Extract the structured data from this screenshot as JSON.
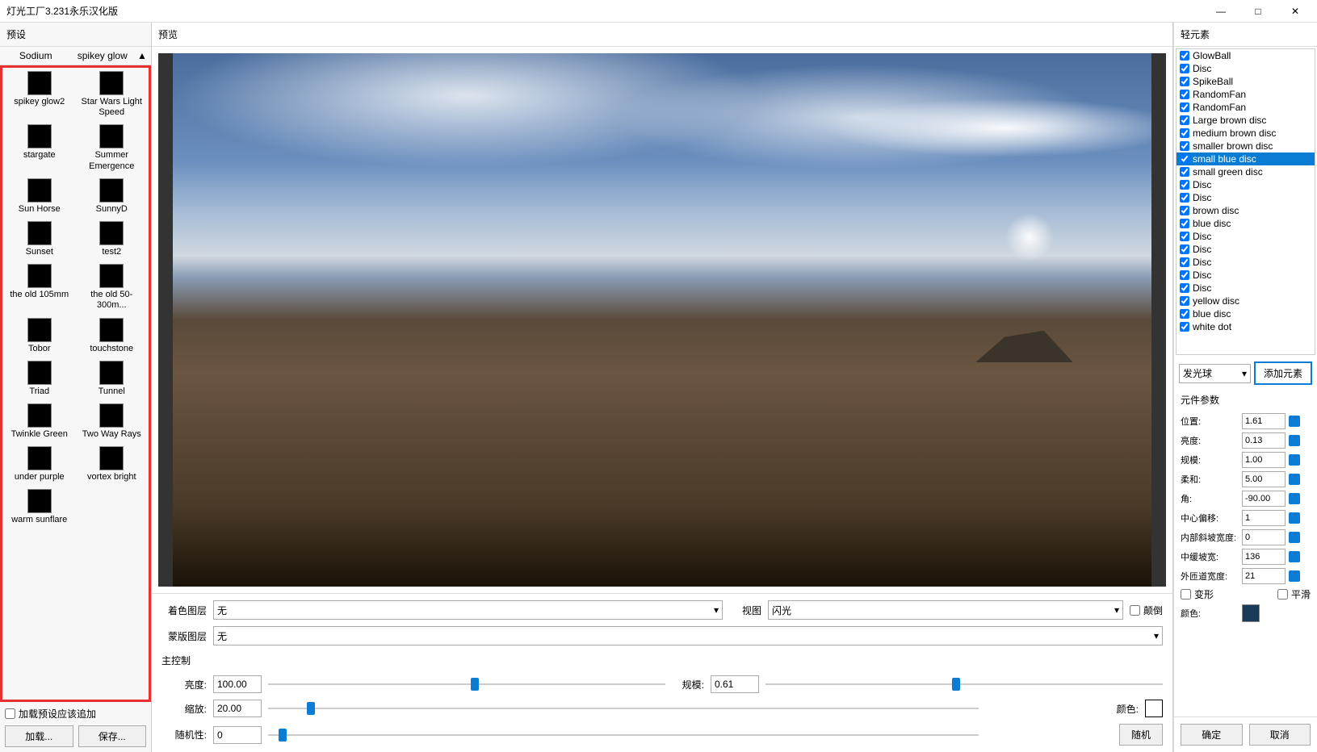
{
  "window": {
    "title": "灯光工厂3.231永乐汉化版"
  },
  "left_panel": {
    "header": "预设",
    "top_labels": [
      "Sodium",
      "spikey glow"
    ],
    "presets": [
      {
        "label": "spikey glow2"
      },
      {
        "label": "Star Wars Light Speed"
      },
      {
        "label": "stargate"
      },
      {
        "label": "Summer Emergence"
      },
      {
        "label": "Sun Horse"
      },
      {
        "label": "SunnyD"
      },
      {
        "label": "Sunset"
      },
      {
        "label": "test2"
      },
      {
        "label": "the old 105mm"
      },
      {
        "label": "the old 50-300m..."
      },
      {
        "label": "Tobor"
      },
      {
        "label": "touchstone"
      },
      {
        "label": "Triad"
      },
      {
        "label": "Tunnel"
      },
      {
        "label": "Twinkle Green"
      },
      {
        "label": "Two Way Rays"
      },
      {
        "label": "under purple"
      },
      {
        "label": "vortex bright"
      },
      {
        "label": "warm sunflare"
      }
    ],
    "load_append_label": "加载预设应该追加",
    "load_btn": "加载...",
    "save_btn": "保存..."
  },
  "center_panel": {
    "header": "预览",
    "color_layer_label": "着色图层",
    "color_layer_value": "无",
    "view_label": "视图",
    "view_value": "闪光",
    "flip_label": "颠倒",
    "mask_layer_label": "蒙版图层",
    "mask_layer_value": "无",
    "master_section": "主控制",
    "brightness_label": "亮度:",
    "brightness_value": "100.00",
    "scale_label": "规模:",
    "scale_value": "0.61",
    "zoom_label": "缩放:",
    "zoom_value": "20.00",
    "color_label": "颜色:",
    "random_label": "随机性:",
    "random_value": "0",
    "random_btn": "随机"
  },
  "right_panel": {
    "header": "轻元素",
    "elements": [
      {
        "name": "GlowBall",
        "checked": true
      },
      {
        "name": "Disc",
        "checked": true
      },
      {
        "name": "SpikeBall",
        "checked": true
      },
      {
        "name": "RandomFan",
        "checked": true
      },
      {
        "name": "RandomFan",
        "checked": true
      },
      {
        "name": "Large brown disc",
        "checked": true
      },
      {
        "name": "medium brown disc",
        "checked": true
      },
      {
        "name": "smaller brown disc",
        "checked": true
      },
      {
        "name": "small blue disc",
        "checked": true,
        "selected": true
      },
      {
        "name": "small green disc",
        "checked": true
      },
      {
        "name": "Disc",
        "checked": true
      },
      {
        "name": "Disc",
        "checked": true
      },
      {
        "name": "brown disc",
        "checked": true
      },
      {
        "name": "blue disc",
        "checked": true
      },
      {
        "name": "Disc",
        "checked": true
      },
      {
        "name": "Disc",
        "checked": true
      },
      {
        "name": "Disc",
        "checked": true
      },
      {
        "name": "Disc",
        "checked": true
      },
      {
        "name": "Disc",
        "checked": true
      },
      {
        "name": "yellow disc",
        "checked": true
      },
      {
        "name": "blue disc",
        "checked": true
      },
      {
        "name": "white dot",
        "checked": true
      }
    ],
    "add_select_value": "发光球",
    "add_btn": "添加元素",
    "params_header": "元件参数",
    "params": {
      "position_label": "位置:",
      "position_value": "1.61",
      "brightness_label": "亮度:",
      "brightness_value": "0.13",
      "scale_label": "规模:",
      "scale_value": "1.00",
      "soft_label": "柔和:",
      "soft_value": "5.00",
      "angle_label": "角:",
      "angle_value": "-90.00",
      "center_offset_label": "中心偏移:",
      "center_offset_value": "1",
      "inner_slope_label": "内部斜坡宽度:",
      "inner_slope_value": "0",
      "mid_slope_label": "中缓坡宽:",
      "mid_slope_value": "136",
      "outer_label": "外匝道宽度:",
      "outer_value": "21",
      "deform_label": "变形",
      "smooth_label": "平滑",
      "color_label": "颜色:"
    },
    "ok_btn": "确定",
    "cancel_btn": "取消"
  }
}
